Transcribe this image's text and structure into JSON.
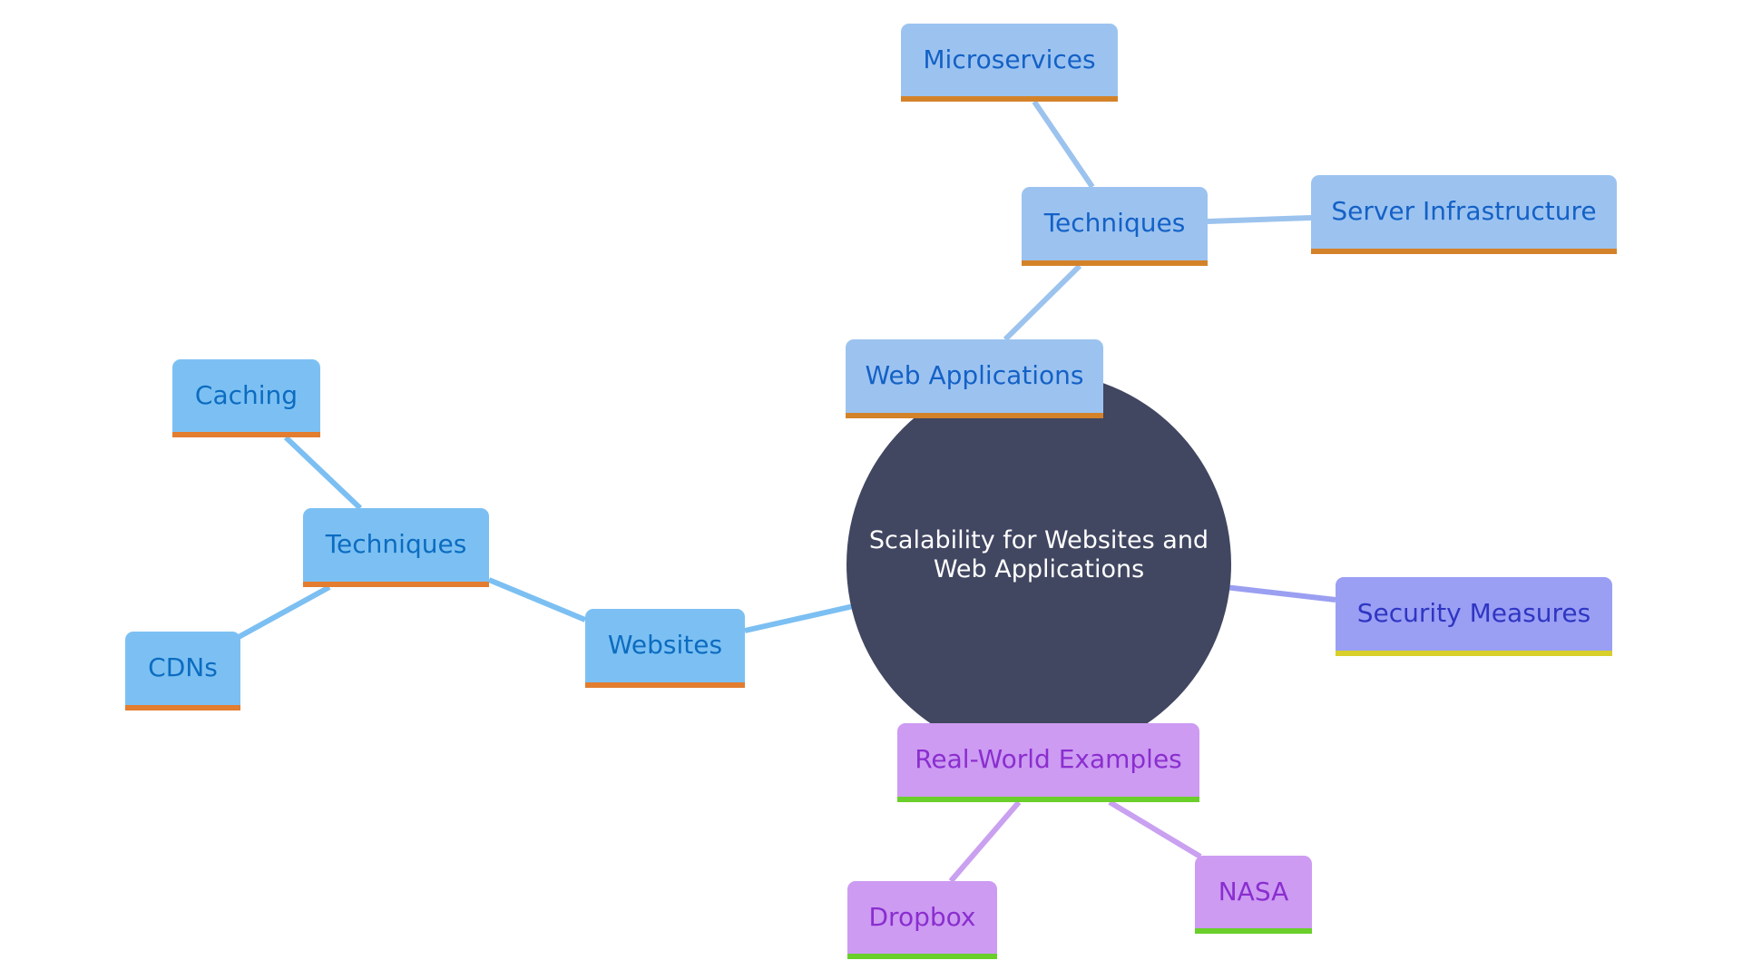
{
  "diagram": {
    "type": "mindmap",
    "root": {
      "label": "Scalability for Websites and Web Applications",
      "color": "#414661"
    },
    "branches": {
      "websites": {
        "label": "Websites",
        "color": "#7cc0f3",
        "children": {
          "techniques": {
            "label": "Techniques",
            "children": {
              "caching": "Caching",
              "cdns": "CDNs"
            }
          }
        }
      },
      "web_applications": {
        "label": "Web Applications",
        "color": "#9cc3f0",
        "children": {
          "techniques": {
            "label": "Techniques",
            "children": {
              "microservices": "Microservices",
              "server_infrastructure": "Server Infrastructure"
            }
          }
        }
      },
      "security": {
        "label": "Security Measures",
        "color": "#9a9ff4"
      },
      "real_world": {
        "label": "Real-World Examples",
        "color": "#cd9bf2",
        "children": {
          "dropbox": "Dropbox",
          "nasa": "NASA"
        }
      }
    },
    "edge_colors": {
      "websites": "#7cbff2",
      "web_applications": "#9cc3ee",
      "security": "#9a9ff1",
      "real_world": "#caa0f0"
    }
  }
}
